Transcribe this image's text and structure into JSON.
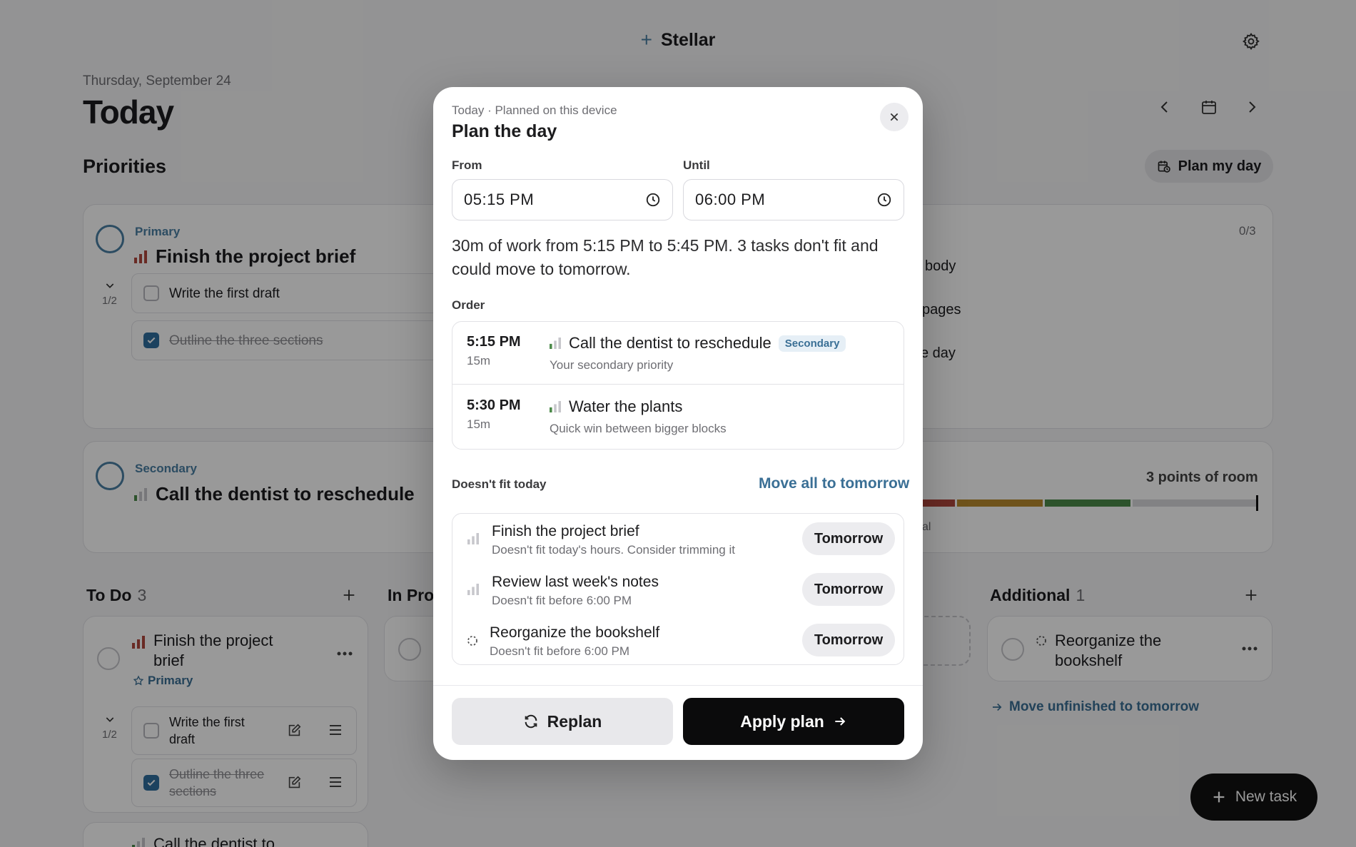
{
  "app": {
    "name": "Stellar"
  },
  "header": {
    "date": "Thursday, September 24",
    "title": "Today"
  },
  "priorities": {
    "heading": "Priorities",
    "plan_button": "Plan my day",
    "primary": {
      "tag": "Primary",
      "title": "Finish the project brief",
      "progress": "1/2",
      "subtasks": [
        {
          "label": "Write the first draft",
          "done": false
        },
        {
          "label": "Outline the three sections",
          "done": true
        }
      ]
    },
    "secondary": {
      "tag": "Secondary",
      "title": "Call the dentist to reschedule"
    },
    "right_card": {
      "count": "0/3",
      "items": [
        "body",
        "pages",
        "e day"
      ]
    },
    "room": {
      "label": "3 points of room",
      "partial": "al",
      "segment_colors": [
        "#b0473d",
        "#b98a2e",
        "#4c8a4a",
        "#d9d9dd"
      ]
    }
  },
  "columns": {
    "todo": {
      "title": "To Do",
      "count": "3",
      "card": {
        "title": "Finish the project brief",
        "tag": "Primary",
        "progress": "1/2",
        "subtasks": [
          {
            "label": "Write the first draft",
            "done": false
          },
          {
            "label": "Outline the three sections",
            "done": true
          }
        ]
      },
      "next_card_title": "Call the dentist to"
    },
    "inprogress": {
      "title": "In Progress"
    },
    "additional": {
      "title": "Additional",
      "count": "1",
      "card_title": "Reorganize the bookshelf",
      "move_link": "Move unfinished to tomorrow"
    }
  },
  "fab": {
    "label": "New task"
  },
  "modal": {
    "subtitle": "Today · Planned on this device",
    "title": "Plan the day",
    "from_label": "From",
    "from_value": "05:15 PM",
    "until_label": "Until",
    "until_value": "06:00 PM",
    "summary": "30m of work from 5:15 PM to 5:45 PM. 3 tasks don't fit and could move to tomorrow.",
    "order_label": "Order",
    "order": [
      {
        "time": "5:15 PM",
        "duration": "15m",
        "name": "Call the dentist to reschedule",
        "badge": "Secondary",
        "note": "Your secondary priority"
      },
      {
        "time": "5:30 PM",
        "duration": "15m",
        "name": "Water the plants",
        "badge": "",
        "note": "Quick win between bigger blocks"
      }
    ],
    "nofit_label": "Doesn't fit today",
    "move_all": "Move all to tomorrow",
    "nofit": [
      {
        "name": "Finish the project brief",
        "note": "Doesn't fit today's hours. Consider trimming it",
        "button": "Tomorrow"
      },
      {
        "name": "Review last week's notes",
        "note": "Doesn't fit before 6:00 PM",
        "button": "Tomorrow"
      },
      {
        "name": "Reorganize the bookshelf",
        "note": "Doesn't fit before 6:00 PM",
        "button": "Tomorrow"
      }
    ],
    "replan": "Replan",
    "apply": "Apply plan"
  },
  "colors": {
    "accent": "#4a7fa3",
    "priority_high": "#b0473d",
    "priority_low": "#4c8a4a"
  },
  "icons": [
    "gear-icon",
    "chevron-left-icon",
    "calendar-icon",
    "chevron-right-icon",
    "close-icon",
    "clock-icon",
    "refresh-icon",
    "arrow-right-icon",
    "plus-icon",
    "priority-bars-icon",
    "star-icon",
    "more-icon",
    "drag-handle-icon",
    "edit-icon",
    "dashed-circle-icon"
  ]
}
